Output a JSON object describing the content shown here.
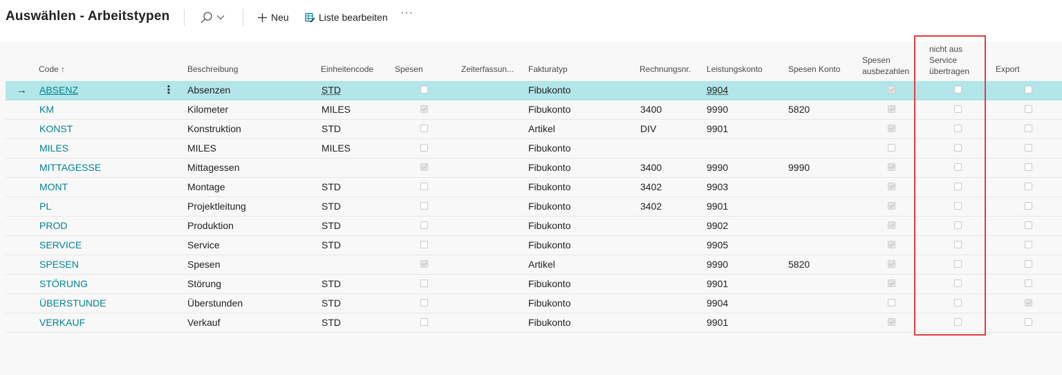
{
  "header": {
    "title": "Auswählen - Arbeitstypen",
    "new_label": "Neu",
    "edit_list_label": "Liste bearbeiten",
    "more_label": "···"
  },
  "columns": {
    "code": "Code",
    "code_sort": "↑",
    "beschreibung": "Beschreibung",
    "einheitencode": "Einheitencode",
    "spesen": "Spesen",
    "zeiterfassung": "Zeiterfassun...",
    "fakturatyp": "Fakturatyp",
    "rechnungsnr": "Rechnungsnr.",
    "leistungskonto": "Leistungskonto",
    "spesen_konto": "Spesen Konto",
    "spesen_ausbezahlen_1": "Spesen",
    "spesen_ausbezahlen_2": "ausbezahlen",
    "nicht_aus_1": "nicht aus",
    "nicht_aus_2": "Service",
    "nicht_aus_3": "übertragen",
    "export": "Export"
  },
  "selected_row_arrow": "→",
  "row_menu": "⋮",
  "rows": [
    {
      "code": "ABSENZ",
      "beschreibung": "Absenzen",
      "einheit": "STD",
      "spesen": false,
      "fakturatyp": "Fibukonto",
      "rechnungsnr": "",
      "leistungskonto": "9904",
      "spesen_konto": "",
      "ausbezahlen": true,
      "nicht_aus": false,
      "export": false
    },
    {
      "code": "KM",
      "beschreibung": "Kilometer",
      "einheit": "MILES",
      "spesen": true,
      "fakturatyp": "Fibukonto",
      "rechnungsnr": "3400",
      "leistungskonto": "9990",
      "spesen_konto": "5820",
      "ausbezahlen": true,
      "nicht_aus": false,
      "export": false
    },
    {
      "code": "KONST",
      "beschreibung": "Konstruktion",
      "einheit": "STD",
      "spesen": false,
      "fakturatyp": "Artikel",
      "rechnungsnr": "DIV",
      "leistungskonto": "9901",
      "spesen_konto": "",
      "ausbezahlen": true,
      "nicht_aus": false,
      "export": false
    },
    {
      "code": "MILES",
      "beschreibung": "MILES",
      "einheit": "MILES",
      "spesen": false,
      "fakturatyp": "Fibukonto",
      "rechnungsnr": "",
      "leistungskonto": "",
      "spesen_konto": "",
      "ausbezahlen": false,
      "nicht_aus": false,
      "export": false
    },
    {
      "code": "MITTAGESSE",
      "beschreibung": "Mittagessen",
      "einheit": "",
      "spesen": true,
      "fakturatyp": "Fibukonto",
      "rechnungsnr": "3400",
      "leistungskonto": "9990",
      "spesen_konto": "9990",
      "ausbezahlen": true,
      "nicht_aus": false,
      "export": false
    },
    {
      "code": "MONT",
      "beschreibung": "Montage",
      "einheit": "STD",
      "spesen": false,
      "fakturatyp": "Fibukonto",
      "rechnungsnr": "3402",
      "leistungskonto": "9903",
      "spesen_konto": "",
      "ausbezahlen": true,
      "nicht_aus": false,
      "export": false
    },
    {
      "code": "PL",
      "beschreibung": "Projektleitung",
      "einheit": "STD",
      "spesen": false,
      "fakturatyp": "Fibukonto",
      "rechnungsnr": "3402",
      "leistungskonto": "9901",
      "spesen_konto": "",
      "ausbezahlen": true,
      "nicht_aus": false,
      "export": false
    },
    {
      "code": "PROD",
      "beschreibung": "Produktion",
      "einheit": "STD",
      "spesen": false,
      "fakturatyp": "Fibukonto",
      "rechnungsnr": "",
      "leistungskonto": "9902",
      "spesen_konto": "",
      "ausbezahlen": true,
      "nicht_aus": false,
      "export": false
    },
    {
      "code": "SERVICE",
      "beschreibung": "Service",
      "einheit": "STD",
      "spesen": false,
      "fakturatyp": "Fibukonto",
      "rechnungsnr": "",
      "leistungskonto": "9905",
      "spesen_konto": "",
      "ausbezahlen": true,
      "nicht_aus": false,
      "export": false
    },
    {
      "code": "SPESEN",
      "beschreibung": "Spesen",
      "einheit": "",
      "spesen": true,
      "fakturatyp": "Artikel",
      "rechnungsnr": "",
      "leistungskonto": "9990",
      "spesen_konto": "5820",
      "ausbezahlen": true,
      "nicht_aus": false,
      "export": false
    },
    {
      "code": "STÖRUNG",
      "beschreibung": "Störung",
      "einheit": "STD",
      "spesen": false,
      "fakturatyp": "Fibukonto",
      "rechnungsnr": "",
      "leistungskonto": "9901",
      "spesen_konto": "",
      "ausbezahlen": true,
      "nicht_aus": false,
      "export": false
    },
    {
      "code": "ÜBERSTUNDE",
      "beschreibung": "Überstunden",
      "einheit": "STD",
      "spesen": false,
      "fakturatyp": "Fibukonto",
      "rechnungsnr": "",
      "leistungskonto": "9904",
      "spesen_konto": "",
      "ausbezahlen": false,
      "nicht_aus": false,
      "export": true
    },
    {
      "code": "VERKAUF",
      "beschreibung": "Verkauf",
      "einheit": "STD",
      "spesen": false,
      "fakturatyp": "Fibukonto",
      "rechnungsnr": "",
      "leistungskonto": "9901",
      "spesen_konto": "",
      "ausbezahlen": true,
      "nicht_aus": false,
      "export": false
    }
  ],
  "colors": {
    "accent": "#00838f",
    "selected_row": "#b3e6e9",
    "highlight_border": "#e03c3c"
  }
}
